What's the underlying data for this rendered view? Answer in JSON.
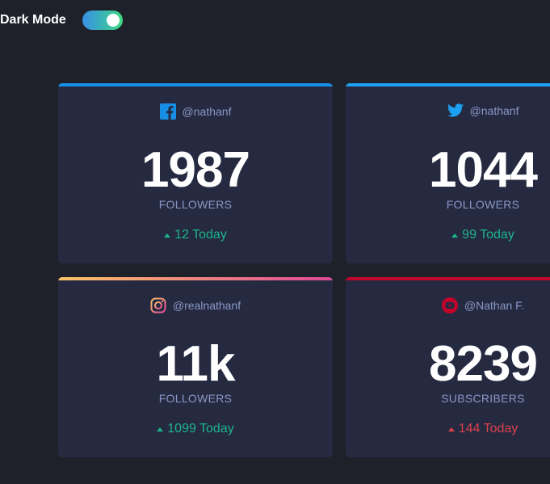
{
  "header": {
    "dark_mode_label": "Dark Mode",
    "dark_mode_on": true
  },
  "cards": [
    {
      "platform": "facebook",
      "icon": "facebook-icon",
      "accent": "#178fe6",
      "handle": "@nathanf",
      "count": "1987",
      "label": "FOLLOWERS",
      "today": "12 Today",
      "trend": "up"
    },
    {
      "platform": "twitter",
      "icon": "twitter-icon",
      "accent": "#1ca0f2",
      "handle": "@nathanf",
      "count": "1044",
      "label": "FOLLOWERS",
      "today": "99 Today",
      "trend": "up"
    },
    {
      "platform": "instagram",
      "icon": "instagram-icon",
      "accent": "#fdc468",
      "handle": "@realnathanf",
      "count": "11k",
      "label": "FOLLOWERS",
      "today": "1099 Today",
      "trend": "up"
    },
    {
      "platform": "youtube",
      "icon": "youtube-icon",
      "accent": "#c4032a",
      "handle": "@Nathan F.",
      "count": "8239",
      "label": "SUBSCRIBERS",
      "today": "144 Today",
      "trend": "down"
    }
  ],
  "colors": {
    "background": "#1e202a",
    "card": "#252a41",
    "up": "#1db489",
    "down": "#dc414c",
    "muted": "#8b97c6"
  }
}
